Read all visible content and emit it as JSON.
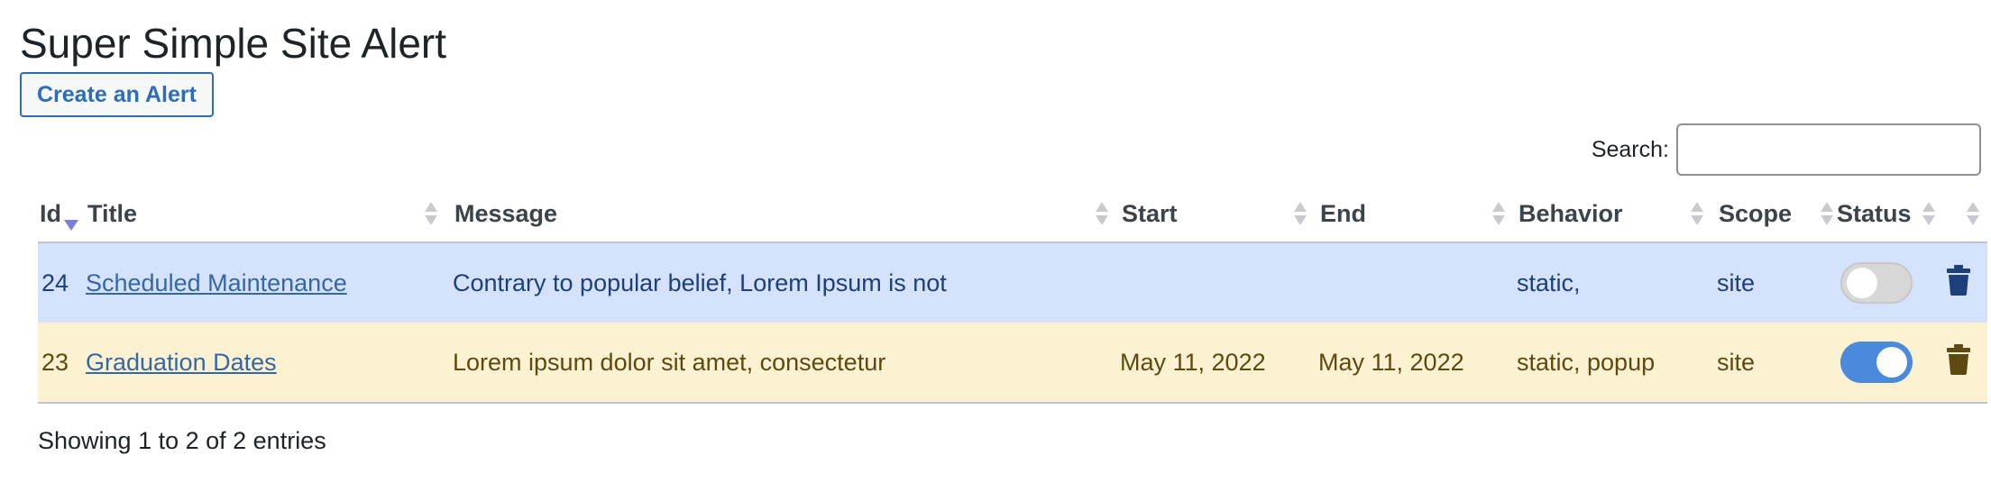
{
  "page": {
    "title": "Super Simple Site Alert"
  },
  "toolbar": {
    "create_label": "Create an Alert"
  },
  "search": {
    "label": "Search:",
    "value": ""
  },
  "table": {
    "columns": [
      "Id",
      "Title",
      "Message",
      "Start",
      "End",
      "Behavior",
      "Scope",
      "Status",
      ""
    ],
    "sorted_column": "Id",
    "sort_direction": "desc",
    "rows": [
      {
        "id": "24",
        "title": "Scheduled Maintenance",
        "message": "Contrary to popular belief, Lorem Ipsum is not",
        "start": "",
        "end": "",
        "behavior": "static,",
        "scope": "site",
        "status_on": false,
        "row_color": "#d5e2fb"
      },
      {
        "id": "23",
        "title": "Graduation Dates",
        "message": "Lorem ipsum dolor sit amet, consectetur",
        "start": "May 11, 2022",
        "end": "May 11, 2022",
        "behavior": "static, popup",
        "scope": "site",
        "status_on": true,
        "row_color": "#fcf2d2"
      }
    ]
  },
  "footer": {
    "info": "Showing 1 to 2 of 2 entries"
  },
  "colors": {
    "accent": "#2c6eb5",
    "toggle_on": "#4a89dc",
    "toggle_off": "#d7d7d7"
  },
  "icons": {
    "delete": "trash-icon"
  }
}
